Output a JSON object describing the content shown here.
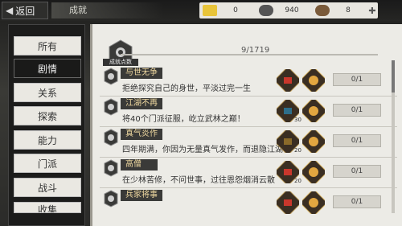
{
  "header": {
    "back_label": "返回",
    "title": "成就",
    "currencies": [
      {
        "icon": "gold-bar-icon",
        "value": "0",
        "color": "#e8c43a"
      },
      {
        "icon": "silver-ingot-icon",
        "value": "940",
        "color": "#555555"
      },
      {
        "icon": "scroll-icon",
        "value": "8",
        "color": "#7a5a3a"
      }
    ]
  },
  "sidebar": {
    "tabs": [
      {
        "label": "所有",
        "active": false
      },
      {
        "label": "剧情",
        "active": true
      },
      {
        "label": "关系",
        "active": false
      },
      {
        "label": "探索",
        "active": false
      },
      {
        "label": "能力",
        "active": false
      },
      {
        "label": "门派",
        "active": false
      },
      {
        "label": "战斗",
        "active": false
      },
      {
        "label": "收集",
        "active": false
      }
    ]
  },
  "summary": {
    "badge_label": "成就点数",
    "progress": "9/1719"
  },
  "achievements": [
    {
      "title": "与世无争",
      "desc": "拒绝探究自己的身世，平淡过完一生",
      "progress": "0/1",
      "reward_count": ""
    },
    {
      "title": "江湖不再",
      "desc": "将40个门派征服，屹立武林之巅！",
      "progress": "0/1",
      "reward_count": "30"
    },
    {
      "title": "真气炎作",
      "desc": "四年期满，你因为无量真气发作，而退隐江湖",
      "progress": "0/1",
      "reward_count": "20"
    },
    {
      "title": "高僧",
      "desc": "在少林苦修，不问世事，过往恩怨烟消云散",
      "progress": "0/1",
      "reward_count": "20"
    },
    {
      "title": "兵家将事",
      "desc": "",
      "progress": "0/1",
      "reward_count": ""
    }
  ],
  "colors": {
    "accent_gold": "#f0d9a0",
    "panel_bg": "#ecebe6"
  }
}
